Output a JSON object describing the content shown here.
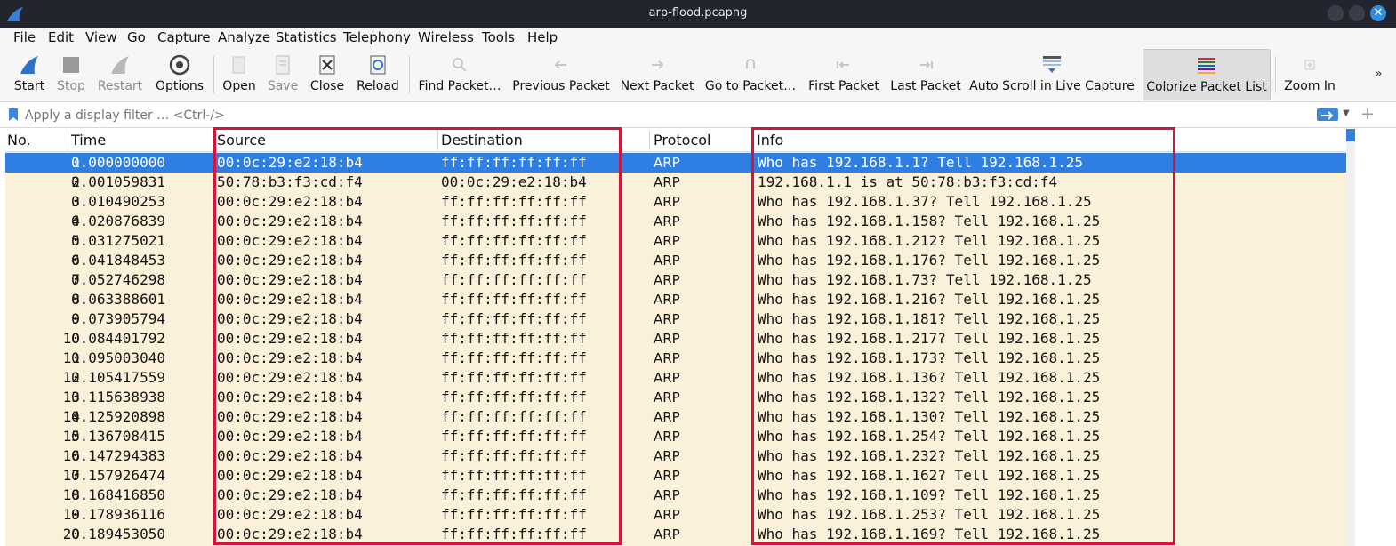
{
  "window": {
    "title": "arp-flood.pcapng"
  },
  "menu": [
    {
      "label": "File",
      "key": "F",
      "rest": "ile"
    },
    {
      "label": "Edit",
      "key": "E",
      "rest": "dit"
    },
    {
      "label": "View",
      "key": "V",
      "rest": "iew"
    },
    {
      "label": "Go",
      "key": "G",
      "rest": "o"
    },
    {
      "label": "Capture",
      "key": "C",
      "rest": "apture"
    },
    {
      "label": "Analyze",
      "key": "A",
      "rest": "nalyze"
    },
    {
      "label": "Statistics",
      "key": "S",
      "rest": "tatistics"
    },
    {
      "label": "Telephony",
      "key": "y",
      "rest": ""
    },
    {
      "label": "Wireless",
      "key": "W",
      "rest": "ireless"
    },
    {
      "label": "Tools",
      "key": "T",
      "rest": "ools"
    },
    {
      "label": "Help",
      "key": "H",
      "rest": "elp"
    }
  ],
  "toolbar": {
    "start": "Start",
    "stop": "Stop",
    "restart": "Restart",
    "options": "Options",
    "open": "Open",
    "save": "Save",
    "close": "Close",
    "reload": "Reload",
    "find_packet": "Find Packet…",
    "previous_packet": "Previous Packet",
    "next_packet": "Next Packet",
    "go_to_packet": "Go to Packet…",
    "first_packet": "First Packet",
    "last_packet": "Last Packet",
    "auto_scroll": "Auto Scroll in Live Capture",
    "colorize": "Colorize Packet List",
    "zoom_in": "Zoom In",
    "overflow": "»"
  },
  "filter": {
    "placeholder": "Apply a display filter … <Ctrl-/>"
  },
  "columns": {
    "no": "No.",
    "time": "Time",
    "source": "Source",
    "destination": "Destination",
    "protocol": "Protocol",
    "info": "Info"
  },
  "packets": [
    {
      "no": "1",
      "time": "0.000000000",
      "source": "00:0c:29:e2:18:b4",
      "destination": "ff:ff:ff:ff:ff:ff",
      "protocol": "ARP",
      "info": "Who has 192.168.1.1? Tell 192.168.1.25"
    },
    {
      "no": "2",
      "time": "0.001059831",
      "source": "50:78:b3:f3:cd:f4",
      "destination": "00:0c:29:e2:18:b4",
      "protocol": "ARP",
      "info": "192.168.1.1 is at 50:78:b3:f3:cd:f4"
    },
    {
      "no": "3",
      "time": "0.010490253",
      "source": "00:0c:29:e2:18:b4",
      "destination": "ff:ff:ff:ff:ff:ff",
      "protocol": "ARP",
      "info": "Who has 192.168.1.37? Tell 192.168.1.25"
    },
    {
      "no": "4",
      "time": "0.020876839",
      "source": "00:0c:29:e2:18:b4",
      "destination": "ff:ff:ff:ff:ff:ff",
      "protocol": "ARP",
      "info": "Who has 192.168.1.158? Tell 192.168.1.25"
    },
    {
      "no": "5",
      "time": "0.031275021",
      "source": "00:0c:29:e2:18:b4",
      "destination": "ff:ff:ff:ff:ff:ff",
      "protocol": "ARP",
      "info": "Who has 192.168.1.212? Tell 192.168.1.25"
    },
    {
      "no": "6",
      "time": "0.041848453",
      "source": "00:0c:29:e2:18:b4",
      "destination": "ff:ff:ff:ff:ff:ff",
      "protocol": "ARP",
      "info": "Who has 192.168.1.176? Tell 192.168.1.25"
    },
    {
      "no": "7",
      "time": "0.052746298",
      "source": "00:0c:29:e2:18:b4",
      "destination": "ff:ff:ff:ff:ff:ff",
      "protocol": "ARP",
      "info": "Who has 192.168.1.73? Tell 192.168.1.25"
    },
    {
      "no": "8",
      "time": "0.063388601",
      "source": "00:0c:29:e2:18:b4",
      "destination": "ff:ff:ff:ff:ff:ff",
      "protocol": "ARP",
      "info": "Who has 192.168.1.216? Tell 192.168.1.25"
    },
    {
      "no": "9",
      "time": "0.073905794",
      "source": "00:0c:29:e2:18:b4",
      "destination": "ff:ff:ff:ff:ff:ff",
      "protocol": "ARP",
      "info": "Who has 192.168.1.181? Tell 192.168.1.25"
    },
    {
      "no": "10",
      "time": "0.084401792",
      "source": "00:0c:29:e2:18:b4",
      "destination": "ff:ff:ff:ff:ff:ff",
      "protocol": "ARP",
      "info": "Who has 192.168.1.217? Tell 192.168.1.25"
    },
    {
      "no": "11",
      "time": "0.095003040",
      "source": "00:0c:29:e2:18:b4",
      "destination": "ff:ff:ff:ff:ff:ff",
      "protocol": "ARP",
      "info": "Who has 192.168.1.173? Tell 192.168.1.25"
    },
    {
      "no": "12",
      "time": "0.105417559",
      "source": "00:0c:29:e2:18:b4",
      "destination": "ff:ff:ff:ff:ff:ff",
      "protocol": "ARP",
      "info": "Who has 192.168.1.136? Tell 192.168.1.25"
    },
    {
      "no": "13",
      "time": "0.115638938",
      "source": "00:0c:29:e2:18:b4",
      "destination": "ff:ff:ff:ff:ff:ff",
      "protocol": "ARP",
      "info": "Who has 192.168.1.132? Tell 192.168.1.25"
    },
    {
      "no": "14",
      "time": "0.125920898",
      "source": "00:0c:29:e2:18:b4",
      "destination": "ff:ff:ff:ff:ff:ff",
      "protocol": "ARP",
      "info": "Who has 192.168.1.130? Tell 192.168.1.25"
    },
    {
      "no": "15",
      "time": "0.136708415",
      "source": "00:0c:29:e2:18:b4",
      "destination": "ff:ff:ff:ff:ff:ff",
      "protocol": "ARP",
      "info": "Who has 192.168.1.254? Tell 192.168.1.25"
    },
    {
      "no": "16",
      "time": "0.147294383",
      "source": "00:0c:29:e2:18:b4",
      "destination": "ff:ff:ff:ff:ff:ff",
      "protocol": "ARP",
      "info": "Who has 192.168.1.232? Tell 192.168.1.25"
    },
    {
      "no": "17",
      "time": "0.157926474",
      "source": "00:0c:29:e2:18:b4",
      "destination": "ff:ff:ff:ff:ff:ff",
      "protocol": "ARP",
      "info": "Who has 192.168.1.162? Tell 192.168.1.25"
    },
    {
      "no": "18",
      "time": "0.168416850",
      "source": "00:0c:29:e2:18:b4",
      "destination": "ff:ff:ff:ff:ff:ff",
      "protocol": "ARP",
      "info": "Who has 192.168.1.109? Tell 192.168.1.25"
    },
    {
      "no": "19",
      "time": "0.178936116",
      "source": "00:0c:29:e2:18:b4",
      "destination": "ff:ff:ff:ff:ff:ff",
      "protocol": "ARP",
      "info": "Who has 192.168.1.253? Tell 192.168.1.25"
    },
    {
      "no": "20",
      "time": "0.189453050",
      "source": "00:0c:29:e2:18:b4",
      "destination": "ff:ff:ff:ff:ff:ff",
      "protocol": "ARP",
      "info": "Who has 192.168.1.169? Tell 192.168.1.25"
    }
  ],
  "selected_packet": "1",
  "colors": {
    "arp_row_bg": "#fbf0d9",
    "selection": "#2f7fe3",
    "highlight_box": "#d4153b",
    "titlebar": "#23252e"
  }
}
